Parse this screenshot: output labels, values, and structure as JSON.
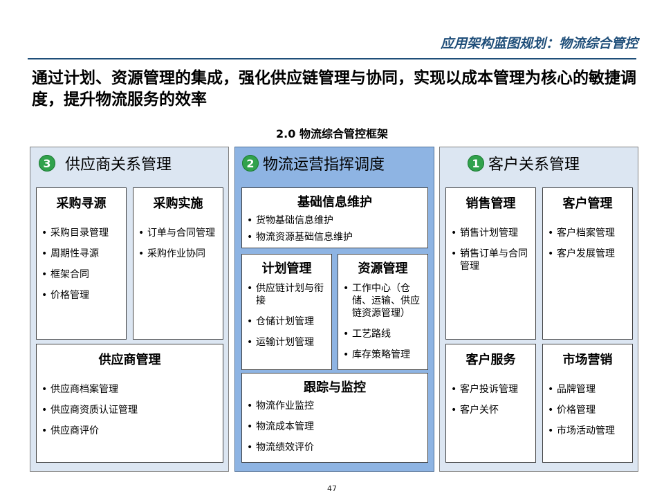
{
  "header": {
    "title": "应用架构蓝图规划：物流综合管控"
  },
  "headline": "通过计划、资源管理的集成，强化供应链管理与协同，实现以成本管理为核心的敏捷调度，提升物流服务的效率",
  "framework_title": "2.0 物流综合管控框架",
  "columns": [
    {
      "number": "3",
      "title": "供应商关系管理",
      "boxes": [
        {
          "title": "采购寻源",
          "items": [
            "采购目录管理",
            "周期性寻源",
            "框架合同",
            "价格管理"
          ]
        },
        {
          "title": "采购实施",
          "items": [
            "订单与合同管理",
            "采购作业协同"
          ]
        },
        {
          "title": "供应商管理",
          "items": [
            "供应商档案管理",
            "供应商资质认证管理",
            "供应商评价"
          ]
        }
      ]
    },
    {
      "number": "2",
      "title": "物流运营指挥调度",
      "boxes": [
        {
          "title": "基础信息维护",
          "items": [
            "货物基础信息维护",
            "物流资源基础信息维护"
          ]
        },
        {
          "title": "计划管理",
          "items": [
            "供应链计划与衔接",
            "仓储计划管理",
            "运输计划管理"
          ]
        },
        {
          "title": "资源管理",
          "items": [
            "工作中心（仓储、运输、供应链资源管理）",
            "工艺路线",
            "库存策略管理"
          ]
        },
        {
          "title": "跟踪与监控",
          "items": [
            "物流作业监控",
            "物流成本管理",
            "物流绩效评价"
          ]
        }
      ]
    },
    {
      "number": "1",
      "title": "客户关系管理",
      "boxes": [
        {
          "title": "销售管理",
          "items": [
            "销售计划管理",
            "销售订单与合同管理"
          ]
        },
        {
          "title": "客户管理",
          "items": [
            "客户档案管理",
            "客户发展管理"
          ]
        },
        {
          "title": "客户服务",
          "items": [
            "客户投诉管理",
            "客户关怀"
          ]
        },
        {
          "title": "市场营销",
          "items": [
            "品牌管理",
            "价格管理",
            "市场活动管理"
          ]
        }
      ]
    }
  ],
  "page_number": "47"
}
